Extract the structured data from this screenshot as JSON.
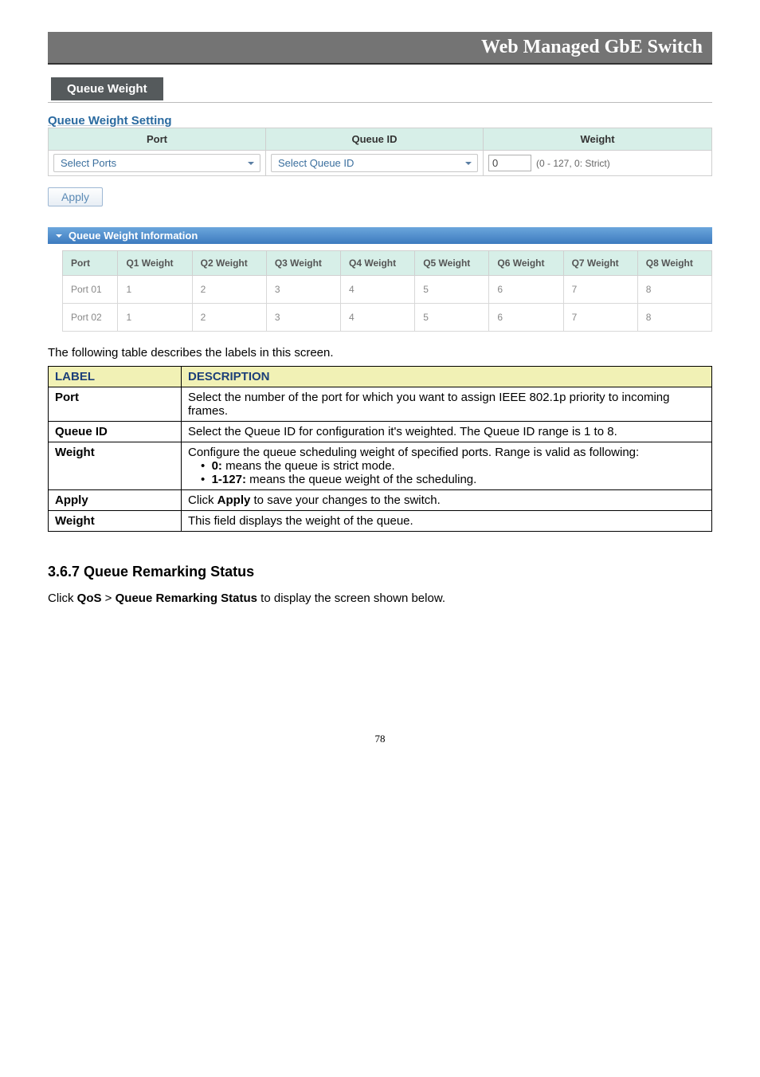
{
  "header": {
    "title": "Web Managed GbE Switch"
  },
  "section_tab": "Queue Weight",
  "setting_title": "Queue Weight Setting",
  "config_table": {
    "headers": {
      "port": "Port",
      "queue_id": "Queue ID",
      "weight": "Weight"
    },
    "port_placeholder": "Select Ports",
    "queue_placeholder": "Select Queue ID",
    "weight_value": "0",
    "weight_hint": "(0 - 127, 0: Strict)"
  },
  "apply_label": "Apply",
  "info_bar_title": "Queue Weight Information",
  "info_table": {
    "headers": [
      "Port",
      "Q1 Weight",
      "Q2 Weight",
      "Q3 Weight",
      "Q4 Weight",
      "Q5 Weight",
      "Q6 Weight",
      "Q7 Weight",
      "Q8 Weight"
    ],
    "rows": [
      {
        "port": "Port 01",
        "cells": [
          "1",
          "2",
          "3",
          "4",
          "5",
          "6",
          "7",
          "8"
        ]
      },
      {
        "port": "Port 02",
        "cells": [
          "1",
          "2",
          "3",
          "4",
          "5",
          "6",
          "7",
          "8"
        ]
      }
    ]
  },
  "caption": "The following table describes the labels in this screen.",
  "desc_table": {
    "headers": {
      "label": "LABEL",
      "desc": "DESCRIPTION"
    },
    "rows": [
      {
        "label": "Port",
        "desc": "Select the number of the port for which you want to assign IEEE 802.1p priority to incoming frames."
      },
      {
        "label": "Queue ID",
        "desc": "Select the Queue ID for configuration it's weighted. The Queue ID range is 1 to 8."
      },
      {
        "label": "Weight",
        "desc": "Configure the queue scheduling weight of specified ports. Range is valid as following:",
        "bullets": [
          {
            "k": "0:",
            "t": " means the queue is strict mode."
          },
          {
            "k": "1-127:",
            "t": " means the queue weight of the scheduling."
          }
        ]
      },
      {
        "label": "Apply",
        "desc_pre": "Click ",
        "desc_bold": "Apply",
        "desc_post": " to save your changes to the switch."
      },
      {
        "label": "Weight",
        "desc": "This field displays the weight of the queue."
      }
    ]
  },
  "sub_heading": "3.6.7 Queue Remarking Status",
  "body_text_pre": "Click ",
  "body_text_b1": "QoS",
  "body_text_mid": " > ",
  "body_text_b2": "Queue Remarking Status",
  "body_text_post": " to display the screen shown below.",
  "page_number": "78"
}
